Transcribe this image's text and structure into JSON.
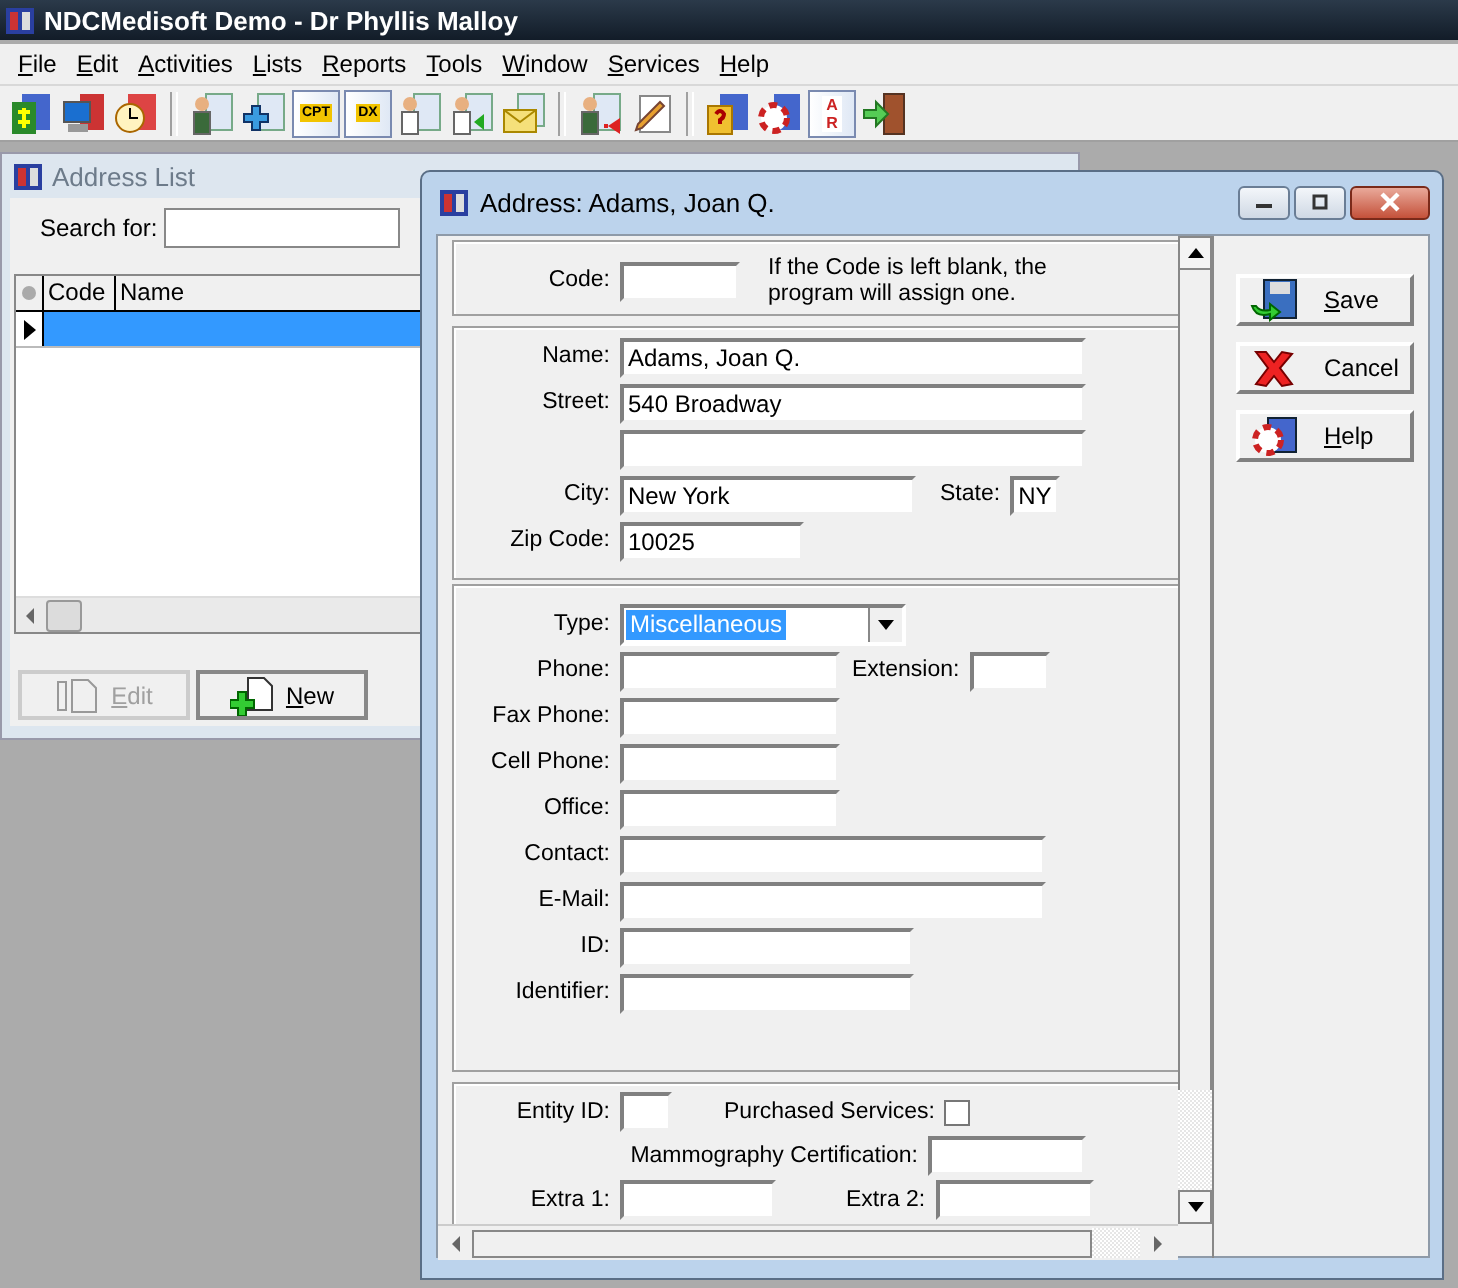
{
  "app_window": {
    "title": "NDCMedisoft Demo - Dr Phyllis Malloy"
  },
  "menu": [
    {
      "label": "File"
    },
    {
      "label": "Edit"
    },
    {
      "label": "Activities"
    },
    {
      "label": "Lists"
    },
    {
      "label": "Reports"
    },
    {
      "label": "Tools"
    },
    {
      "label": "Window"
    },
    {
      "label": "Services"
    },
    {
      "label": "Help"
    }
  ],
  "toolbar": [
    [
      {
        "kind": "money"
      },
      {
        "kind": "computer"
      },
      {
        "kind": "clock"
      }
    ],
    [
      {
        "kind": "person"
      },
      {
        "kind": "plus"
      },
      {
        "kind": "code",
        "glyph": "CPT"
      },
      {
        "kind": "code",
        "glyph": "DX"
      },
      {
        "kind": "doctor"
      },
      {
        "kind": "doctor-arrow"
      },
      {
        "kind": "envelope"
      }
    ],
    [
      {
        "kind": "person-arrow"
      },
      {
        "kind": "pencil"
      }
    ],
    [
      {
        "kind": "question"
      },
      {
        "kind": "lifebuoy"
      },
      {
        "kind": "code",
        "glyph": "AR"
      },
      {
        "kind": "exit"
      }
    ]
  ],
  "address_list": {
    "title": "Address List",
    "search_label": "Search for:",
    "columns": [
      "Code",
      "Name"
    ],
    "rows": [
      {
        "selected": true
      }
    ],
    "buttons": [
      {
        "label": "Edit",
        "disabled": true,
        "kind": "edit"
      },
      {
        "label": "New",
        "disabled": false,
        "kind": "new"
      }
    ]
  },
  "dialog": {
    "title": "Address: Adams, Joan Q.",
    "sections": [
      {
        "rows": [
          [
            {
              "kind": "text",
              "label": "Code:"
            },
            {
              "kind": "note",
              "lines": [
                "If the Code is left blank, the",
                "program will assign one."
              ]
            }
          ]
        ]
      },
      {
        "rows": [
          [
            {
              "kind": "text",
              "label": "Name:",
              "value": "Adams, Joan Q."
            }
          ],
          [
            {
              "kind": "text",
              "label": "Street:",
              "value": "540 Broadway"
            }
          ],
          [
            {
              "kind": "text"
            }
          ],
          [
            {
              "kind": "text",
              "label": "City:",
              "value": "New York"
            },
            {
              "kind": "text",
              "label": "State:",
              "value": "NY"
            }
          ],
          [
            {
              "kind": "text",
              "label": "Zip Code:",
              "value": "10025"
            }
          ]
        ]
      },
      {
        "rows": [
          [
            {
              "kind": "dropdown",
              "label": "Type:",
              "value": "Miscellaneous",
              "focused": true
            }
          ],
          [
            {
              "kind": "text",
              "label": "Phone:"
            },
            {
              "kind": "text",
              "label": "Extension:"
            }
          ],
          [
            {
              "kind": "text",
              "label": "Fax Phone:"
            }
          ],
          [
            {
              "kind": "text",
              "label": "Cell Phone:"
            }
          ],
          [
            {
              "kind": "text",
              "label": "Office:"
            }
          ],
          [
            {
              "kind": "text",
              "label": "Contact:"
            }
          ],
          [
            {
              "kind": "text",
              "label": "E-Mail:"
            }
          ],
          [
            {
              "kind": "text",
              "label": "ID:"
            }
          ],
          [
            {
              "kind": "text",
              "label": "Identifier:"
            }
          ]
        ]
      },
      {
        "rows": [
          [
            {
              "kind": "text",
              "label": "Entity ID:"
            },
            {
              "kind": "checkbox",
              "label": "Purchased Services:",
              "checked": false
            }
          ],
          [
            {
              "kind": "blank"
            },
            {
              "kind": "text",
              "label": "Mammography Certification:"
            }
          ],
          [
            {
              "kind": "text",
              "label": "Extra 1:"
            },
            {
              "kind": "text",
              "label": "Extra 2:"
            }
          ]
        ]
      }
    ],
    "buttons": [
      {
        "label": "Save",
        "kind": "save"
      },
      {
        "label": "Cancel",
        "kind": "cancel"
      },
      {
        "label": "Help",
        "kind": "help"
      }
    ]
  }
}
